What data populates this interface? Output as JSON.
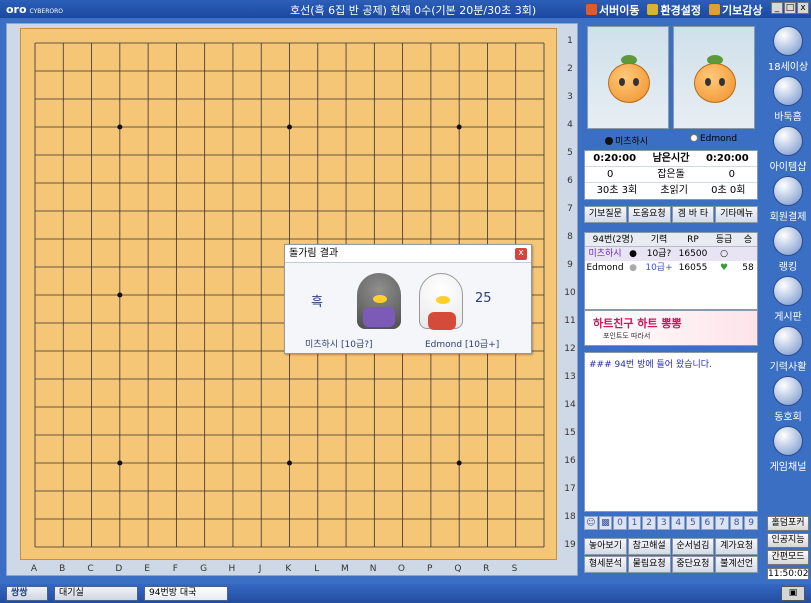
{
  "app": {
    "logo": "oro",
    "logo_sub": "CYBERORO",
    "game_info": "호선(흑 6집 반 공제) 현재 0수(기본 20분/30초 3회)",
    "menu": [
      "서버이동",
      "환경설정",
      "기보감상"
    ],
    "menu_icon_colors": [
      "#e05a2a",
      "#d6b62a",
      "#e0a030"
    ],
    "window_buttons": [
      "_",
      "□",
      "x"
    ]
  },
  "board": {
    "size": 19,
    "row_labels": [
      "1",
      "2",
      "3",
      "4",
      "5",
      "6",
      "7",
      "8",
      "9",
      "10",
      "11",
      "12",
      "13",
      "14",
      "15",
      "16",
      "17",
      "18",
      "19"
    ],
    "col_labels": [
      "A",
      "B",
      "C",
      "D",
      "E",
      "F",
      "G",
      "H",
      "J",
      "K",
      "L",
      "M",
      "N",
      "O",
      "P",
      "Q",
      "R",
      "S"
    ],
    "board_color": "#f6c677",
    "line_color": "#333333"
  },
  "players": {
    "black_name": "미츠하시",
    "white_name": "Edmond",
    "black_time": "0:20:00",
    "remaining_label": "남은시간",
    "white_time": "0:20:00",
    "black_captured": "0",
    "captured_label": "잡은돌",
    "white_captured": "0",
    "black_byoyomi": "30초 3회",
    "byoyomi_label": "초읽기",
    "white_byoyomi": "0초 0회"
  },
  "buttons_row1": [
    "기보질문",
    "도움요청",
    "겜 바 타",
    "기타메뉴"
  ],
  "room_table": {
    "headers": [
      "94번(2명)",
      "기력",
      "RP",
      "등급",
      "승"
    ],
    "rows": [
      {
        "name": "미츠하시",
        "stone": "black",
        "rank": "10급?",
        "rp": "16500",
        "grade": "○",
        "wins": ""
      },
      {
        "name": "Edmond",
        "stone": "white",
        "rank": "10급+",
        "rp": "16055",
        "grade": "♥",
        "wins": "58"
      }
    ]
  },
  "ad": {
    "line1": "하트친구 하트 뽕뽕",
    "line2": "포인트도 따라서"
  },
  "chat": {
    "message": "### 94번 방에 들어 왔습니다."
  },
  "num_row": [
    "☺",
    "▩",
    "0",
    "1",
    "2",
    "3",
    "4",
    "5",
    "6",
    "7",
    "8",
    "9"
  ],
  "buttons_row2": [
    "놓아보기",
    "참고해설",
    "순서넘김",
    "계가요청"
  ],
  "buttons_row3": [
    "형세분석",
    "물림요청",
    "중단요청",
    "불계선언"
  ],
  "right_menu": [
    {
      "label": "18세이상",
      "icon": "badge-18-icon"
    },
    {
      "label": "바둑홈",
      "icon": "home-icon"
    },
    {
      "label": "아이템샵",
      "icon": "shop-icon"
    },
    {
      "label": "회원결제",
      "icon": "payment-icon"
    },
    {
      "label": "랭킹",
      "icon": "ranking-icon"
    },
    {
      "label": "게시판",
      "icon": "board-icon"
    },
    {
      "label": "기력사활",
      "icon": "puzzle-icon"
    },
    {
      "label": "동호회",
      "icon": "club-icon"
    },
    {
      "label": "게임채널",
      "icon": "gamepad-icon"
    }
  ],
  "right_buttons": [
    "홀덤포커",
    "인공지능",
    "간편모드"
  ],
  "clock": "11:50:02",
  "popup": {
    "title": "돌가림 결과",
    "black_result": "흑",
    "white_result": "25",
    "black_label": "미츠하시 [10급?]",
    "white_label": "Edmond [10급+]",
    "close": "x"
  },
  "taskbar": {
    "items": [
      "쌍쌍",
      "대기실",
      "94번방 대국"
    ],
    "right": "▣"
  }
}
